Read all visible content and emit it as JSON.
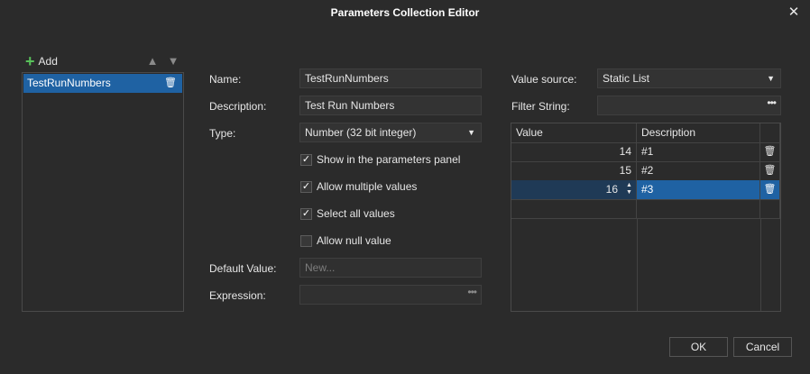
{
  "window": {
    "title": "Parameters Collection Editor",
    "close_glyph": "✕"
  },
  "list": {
    "add_label": "Add",
    "items": [
      {
        "name": "TestRunNumbers",
        "selected": true
      }
    ]
  },
  "form": {
    "name_label": "Name:",
    "name_value": "TestRunNumbers",
    "description_label": "Description:",
    "description_value": "Test Run Numbers",
    "type_label": "Type:",
    "type_value": "Number (32 bit integer)",
    "checkboxes": [
      {
        "label": "Show in the parameters panel",
        "checked": true
      },
      {
        "label": "Allow multiple values",
        "checked": true
      },
      {
        "label": "Select all values",
        "checked": true
      },
      {
        "label": "Allow null value",
        "checked": false
      }
    ],
    "default_value_label": "Default Value:",
    "default_value_placeholder": "New...",
    "expression_label": "Expression:"
  },
  "source": {
    "value_source_label": "Value source:",
    "value_source_value": "Static List",
    "filter_label": "Filter String:",
    "filter_value": ""
  },
  "grid": {
    "headers": [
      "Value",
      "Description"
    ],
    "rows": [
      {
        "value": "14",
        "description": "#1",
        "selected": false
      },
      {
        "value": "15",
        "description": "#2",
        "selected": false
      },
      {
        "value": "16",
        "description": "#3",
        "selected": true
      }
    ]
  },
  "buttons": {
    "ok": "OK",
    "cancel": "Cancel"
  },
  "colors": {
    "background": "#2b2b2b",
    "selection": "#1f62a3",
    "add_icon": "#58c25a"
  }
}
